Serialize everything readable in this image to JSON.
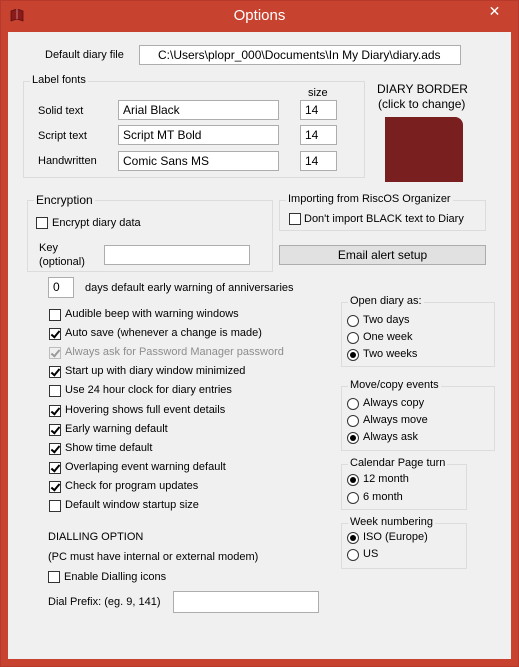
{
  "window": {
    "title": "Options",
    "close_glyph": "✕",
    "app_icon": "diary-book-icon"
  },
  "default_diary": {
    "label": "Default diary file",
    "path": "C:\\Users\\plopr_000\\Documents\\In My Diary\\diary.ads"
  },
  "label_fonts": {
    "legend": "Label fonts",
    "size_header": "size",
    "rows": [
      {
        "label": "Solid text",
        "font": "Arial Black",
        "size": "14"
      },
      {
        "label": "Script text",
        "font": "Script MT Bold",
        "size": "14"
      },
      {
        "label": "Handwritten",
        "font": "Comic Sans MS",
        "size": "14"
      }
    ]
  },
  "diary_border": {
    "title": "DIARY BORDER",
    "subtitle": "(click to change)",
    "color": "#7a1f1f"
  },
  "encryption": {
    "legend": "Encryption",
    "encrypt_label": "Encrypt diary data",
    "encrypt_checked": false,
    "key_label_1": "Key",
    "key_label_2": "(optional)",
    "key_value": ""
  },
  "riscos": {
    "legend": "Importing from RiscOS Organizer",
    "dont_import_label": "Don't import BLACK text to Diary",
    "checked": false
  },
  "email_button": "Email alert setup",
  "early_warning": {
    "days": "0",
    "label": "days default early warning of anniversaries"
  },
  "options": [
    {
      "label": "Audible beep with warning windows",
      "checked": false,
      "disabled": false
    },
    {
      "label": "Auto save (whenever a change is made)",
      "checked": true,
      "disabled": false
    },
    {
      "label": "Always ask for Password Manager password",
      "checked": true,
      "disabled": true
    },
    {
      "label": "Start up with diary window minimized",
      "checked": true,
      "disabled": false
    },
    {
      "label": "Use 24 hour clock for diary entries",
      "checked": false,
      "disabled": false
    },
    {
      "label": "Hovering shows full event details",
      "checked": true,
      "disabled": false
    },
    {
      "label": "Early warning default",
      "checked": true,
      "disabled": false
    },
    {
      "label": "Show time default",
      "checked": true,
      "disabled": false
    },
    {
      "label": "Overlaping event warning default",
      "checked": true,
      "disabled": false
    },
    {
      "label": "Check for program updates",
      "checked": true,
      "disabled": false
    },
    {
      "label": "Default window startup size",
      "checked": false,
      "disabled": false
    }
  ],
  "open_diary": {
    "legend": "Open diary as:",
    "options": [
      {
        "label": "Two days",
        "selected": false
      },
      {
        "label": "One week",
        "selected": false
      },
      {
        "label": "Two weeks",
        "selected": true
      }
    ]
  },
  "move_copy": {
    "legend": "Move/copy events",
    "options": [
      {
        "label": "Always copy",
        "selected": false
      },
      {
        "label": "Always move",
        "selected": false
      },
      {
        "label": "Always ask",
        "selected": true
      }
    ]
  },
  "calendar_turn": {
    "legend": "Calendar Page turn",
    "options": [
      {
        "label": "12 month",
        "selected": true
      },
      {
        "label": "6 month",
        "selected": false
      }
    ]
  },
  "week_numbering": {
    "legend": "Week numbering",
    "options": [
      {
        "label": "ISO (Europe)",
        "selected": true
      },
      {
        "label": "US",
        "selected": false
      }
    ]
  },
  "dialling": {
    "heading": "DIALLING OPTION",
    "note": "(PC must have internal or external modem)",
    "enable_label": "Enable Dialling icons",
    "enable_checked": false,
    "prefix_label": "Dial Prefix: (eg. 9, 141)",
    "prefix_value": ""
  }
}
